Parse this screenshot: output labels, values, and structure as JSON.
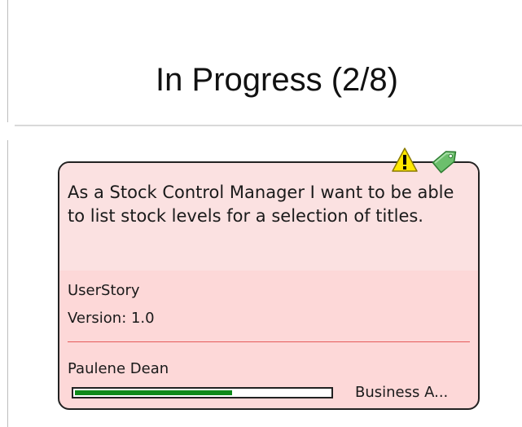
{
  "column": {
    "title": "In Progress (2/8)"
  },
  "card": {
    "description": "As a Stock Control Manager I want to be able to list stock levels for a selection of titles.",
    "stereotype": "UserStory",
    "version": "Version: 1.0",
    "author": "Paulene Dean",
    "phase": "Business A...",
    "progress_percent": 62,
    "icons": {
      "warning": "warning-icon",
      "tag": "green-tag-icon"
    },
    "colors": {
      "background": "#fdd8d8",
      "progress": "#0e8a1a",
      "divider": "#e55b5b"
    }
  }
}
